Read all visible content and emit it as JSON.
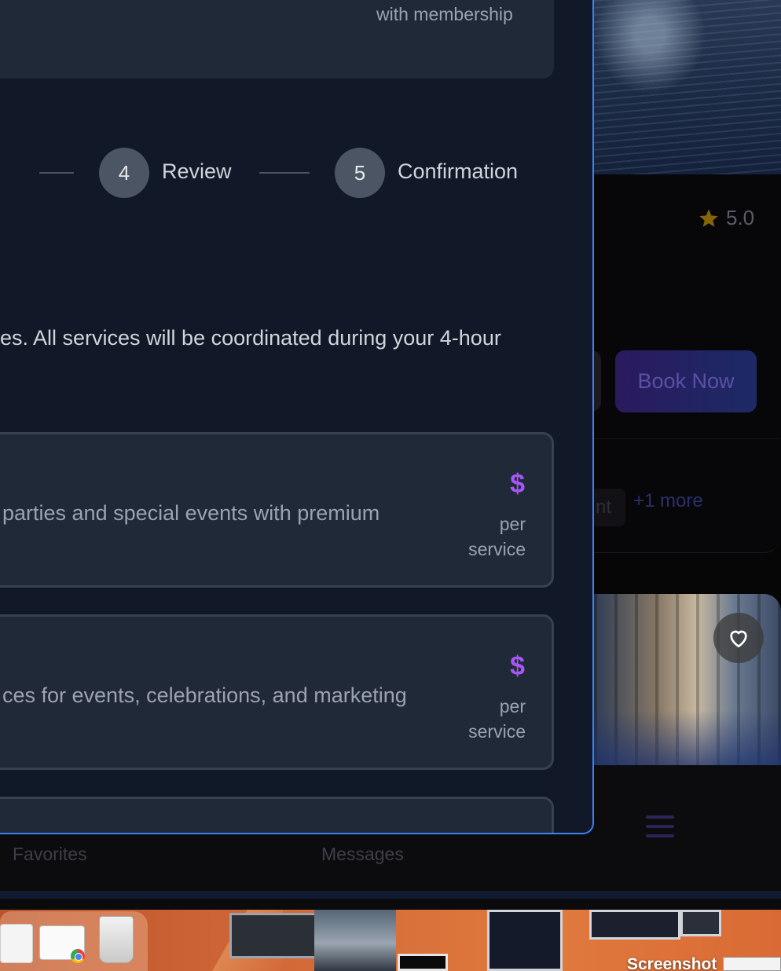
{
  "membership": {
    "text": "with membership"
  },
  "steps": [
    {
      "number": "4",
      "label": "Review"
    },
    {
      "number": "5",
      "label": "Confirmation"
    }
  ],
  "intro": {
    "text": "es. All services will be coordinated during your 4-hour"
  },
  "services": [
    {
      "description": "parties and special events with premium",
      "price_symbol": "$",
      "price_unit": "per service"
    },
    {
      "description": "ces for events, celebrations, and marketing",
      "price_symbol": "$",
      "price_unit": "per service"
    }
  ],
  "background_listing": {
    "rating": "5.0",
    "book_now_label": "Book Now",
    "tag_partial": "nt",
    "more_tags": "+1 more"
  },
  "bottom_nav": {
    "favorites": "Favorites",
    "messages": "Messages"
  },
  "dock": {
    "screenshot_label": "Screenshot"
  },
  "colors": {
    "modal_bg": "#111827",
    "card_bg": "#1f2937",
    "accent_price": "#a855f7",
    "focus_border": "#3b82f6"
  }
}
